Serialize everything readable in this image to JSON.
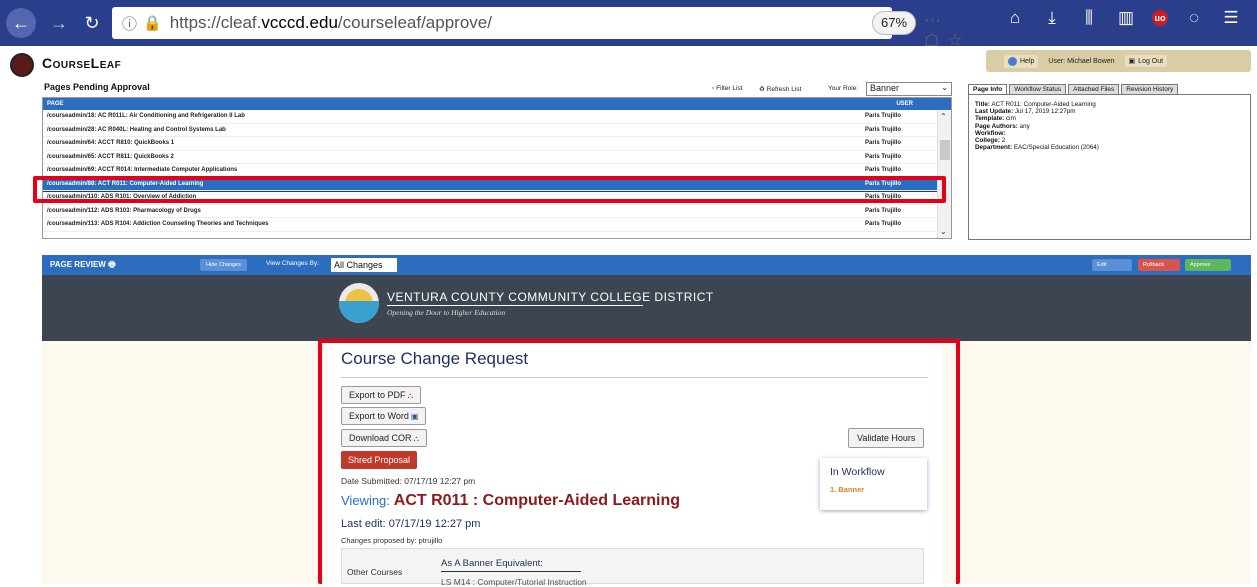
{
  "browser": {
    "url_prefix": "https://cleaf.",
    "url_host": "vcccd.edu",
    "url_path": "/courseleaf/approve/",
    "zoom": "67%"
  },
  "courseleaf": {
    "app_name": "CourseLeaf",
    "help": "Help",
    "user": "User: Michael Bowen",
    "logout": "Log Out"
  },
  "pending": {
    "title": "Pages Pending Approval",
    "filter_list": "Filter List",
    "refresh_list": "Refresh List",
    "role_label": "Your Role:",
    "role_value": "Banner",
    "col_page": "PAGE",
    "col_user": "USER",
    "rows": [
      {
        "page": "/courseadmin/18: AC R011L: Air Conditioning and Refrigeration II Lab",
        "user": "Paris Trujillo"
      },
      {
        "page": "/courseadmin/28: AC R040L: Heating and Control Systems Lab",
        "user": "Paris Trujillo"
      },
      {
        "page": "/courseadmin/64: ACCT R810: QuickBooks 1",
        "user": "Paris Trujillo"
      },
      {
        "page": "/courseadmin/65: ACCT R811: QuickBooks 2",
        "user": "Paris Trujillo"
      },
      {
        "page": "/courseadmin/69: ACCT R014: Intermediate Computer Applications",
        "user": "Paris Trujillo"
      },
      {
        "page": "/courseadmin/88: ACT R011: Computer-Aided Learning",
        "user": "Paris Trujillo"
      },
      {
        "page": "/courseadmin/110: ADS R101: Overview of Addiction",
        "user": "Paris Trujillo"
      },
      {
        "page": "/courseadmin/112: ADS R103: Pharmacology of Drugs",
        "user": "Paris Trujillo"
      },
      {
        "page": "/courseadmin/113: ADS R104: Addiction Counseling Theories and Techniques",
        "user": "Paris Trujillo"
      }
    ]
  },
  "info_tabs": [
    "Page Info",
    "Workflow Status",
    "Attached Files",
    "Revision History"
  ],
  "page_info": {
    "title_label": "Title:",
    "title": "ACT R011: Computer-Aided Learning",
    "update_label": "Last Update:",
    "update": "Jul 17, 2019 12:27pm",
    "template_label": "Template:",
    "template": "cim",
    "authors_label": "Page Authors:",
    "authors": "any",
    "workflow_label": "Workflow:",
    "college_label": "College:",
    "college": "2",
    "dept_label": "Department:",
    "dept": "EAC/Special Education (2064)"
  },
  "review": {
    "title": "PAGE REVIEW",
    "hide_changes": "Hide Changes",
    "view_label": "View Changes By:",
    "view_value": "All Changes",
    "edit": "Edit",
    "rollback": "Rollback",
    "approve": "Approve"
  },
  "district": {
    "name": "VENTURA COUNTY COMMUNITY COLLEGE DISTRICT",
    "tagline": "Opening the Door to Higher Education"
  },
  "doc": {
    "title": "Course Change Request",
    "export_pdf": "Export to PDF",
    "export_word": "Export to Word",
    "download_cor": "Download COR",
    "shred": "Shred Proposal",
    "validate": "Validate Hours",
    "workflow_title": "In Workflow",
    "workflow_item": "1. Banner",
    "submitted": "Date Submitted: 07/17/19 12:27 pm",
    "viewing_label": "Viewing:",
    "viewing": "ACT R011 : Computer-Aided Learning",
    "last_edit": "Last edit: 07/17/19 12:27 pm",
    "proposed": "Changes proposed by: ptrujillo",
    "other_courses": "Other Courses",
    "banner_equiv": "As A Banner Equivalent:",
    "banner_sub": "LS M14 : Computer/Tutorial Instruction"
  }
}
